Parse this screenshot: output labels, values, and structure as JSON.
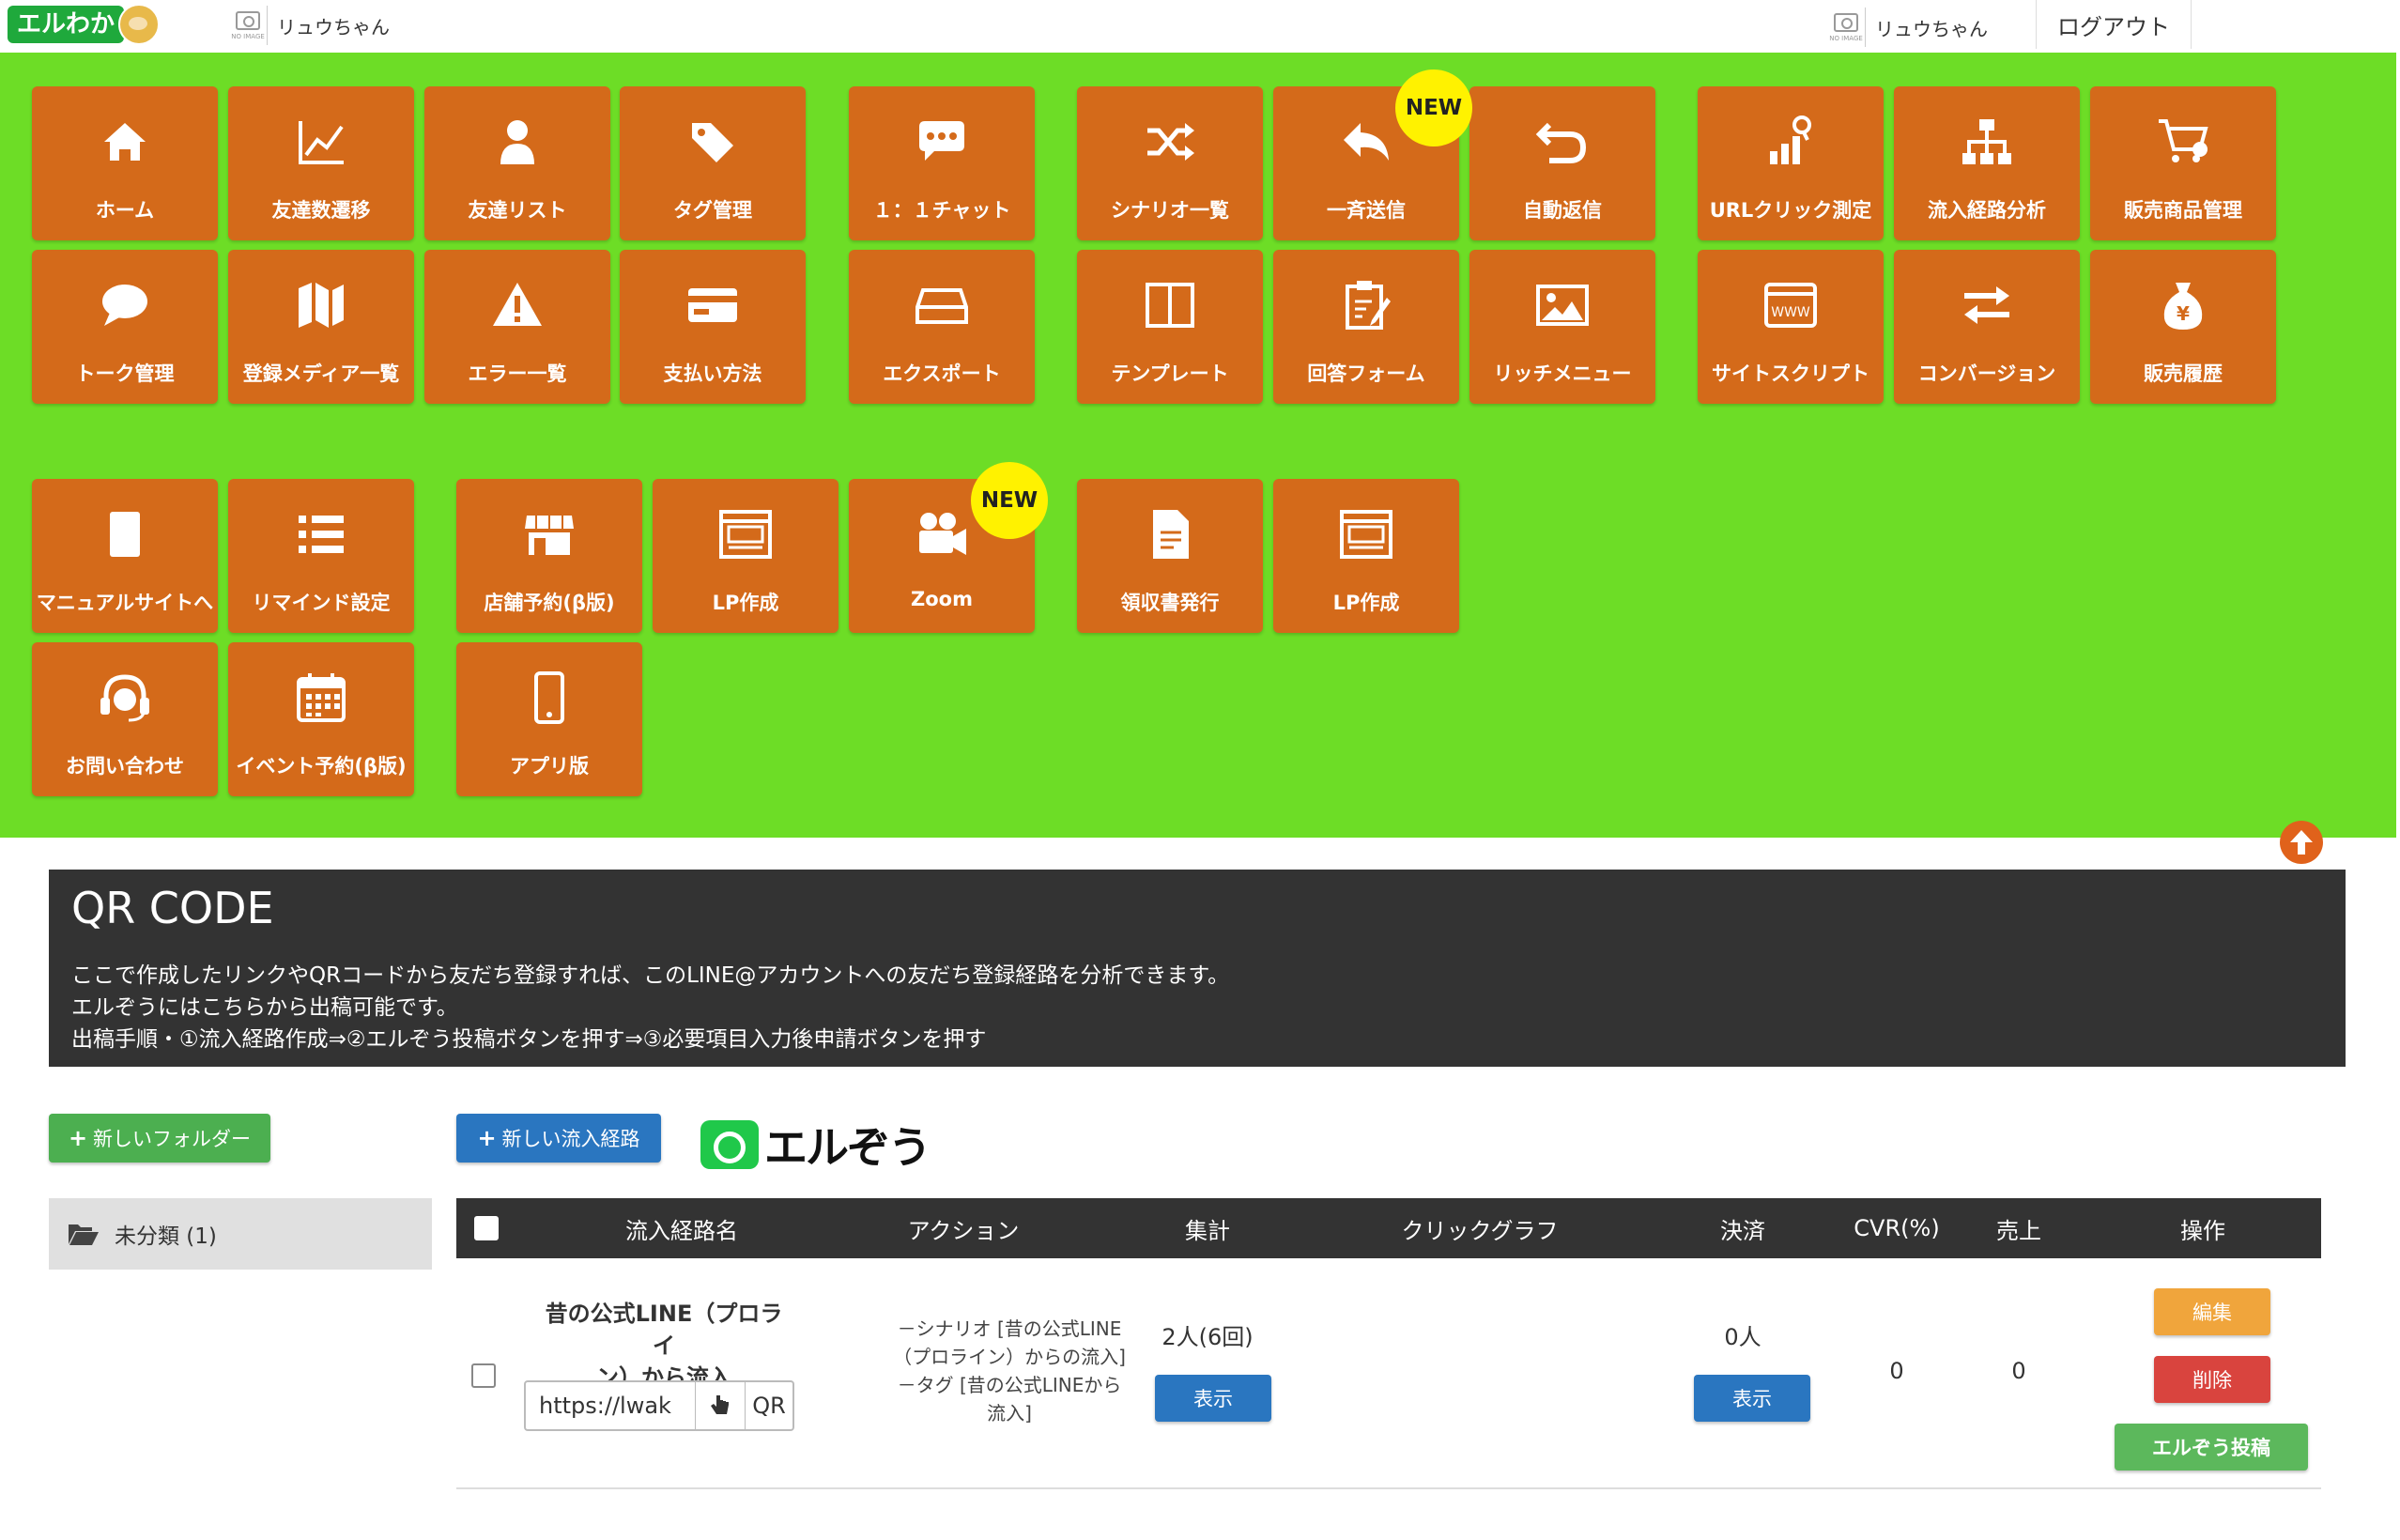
{
  "header": {
    "logo_text": "エルわか",
    "account_left": "リュウちゃん",
    "account_right": "リュウちゃん",
    "noimage_label": "NO IMAGE",
    "logout": "ログアウト"
  },
  "nav": {
    "new_badge": "NEW",
    "tiles": [
      {
        "label": "ホーム",
        "icon": "home-icon"
      },
      {
        "label": "友達数遷移",
        "icon": "line-chart-icon"
      },
      {
        "label": "友達リスト",
        "icon": "user-icon"
      },
      {
        "label": "タグ管理",
        "icon": "tags-icon"
      },
      {
        "label": "１：１チャット",
        "icon": "chat-dots-icon"
      },
      {
        "label": "シナリオ一覧",
        "icon": "shuffle-icon"
      },
      {
        "label": "一斉送信",
        "icon": "reply-icon"
      },
      {
        "label": "自動返信",
        "icon": "undo-icon"
      },
      {
        "label": "URLクリック測定",
        "icon": "bar-search-icon"
      },
      {
        "label": "流入経路分析",
        "icon": "sitemap-icon"
      },
      {
        "label": "販売商品管理",
        "icon": "cart-icon"
      },
      {
        "label": "トーク管理",
        "icon": "speech-bubble-icon"
      },
      {
        "label": "登録メディア一覧",
        "icon": "map-icon"
      },
      {
        "label": "エラー一覧",
        "icon": "warning-icon"
      },
      {
        "label": "支払い方法",
        "icon": "credit-card-icon"
      },
      {
        "label": "エクスポート",
        "icon": "inbox-icon"
      },
      {
        "label": "テンプレート",
        "icon": "columns-icon"
      },
      {
        "label": "回答フォーム",
        "icon": "clipboard-icon"
      },
      {
        "label": "リッチメニュー",
        "icon": "image-icon"
      },
      {
        "label": "サイトスクリプト",
        "icon": "www-icon"
      },
      {
        "label": "コンバージョン",
        "icon": "exchange-icon"
      },
      {
        "label": "販売履歴",
        "icon": "yen-bag-icon"
      },
      {
        "label": "マニュアルサイトへ",
        "icon": "book-icon"
      },
      {
        "label": "リマインド設定",
        "icon": "list-icon"
      },
      {
        "label": "店舗予約(β版)",
        "icon": "store-icon"
      },
      {
        "label": "LP作成",
        "icon": "webpage-icon"
      },
      {
        "label": "Zoom",
        "icon": "video-camera-icon"
      },
      {
        "label": "領収書発行",
        "icon": "document-icon"
      },
      {
        "label": "LP作成",
        "icon": "webpage-icon"
      },
      {
        "label": "お問い合わせ",
        "icon": "headset-icon"
      },
      {
        "label": "イベント予約(β版)",
        "icon": "calendar-icon"
      },
      {
        "label": "アプリ版",
        "icon": "mobile-icon"
      }
    ]
  },
  "qr": {
    "title": "QR CODE",
    "line1": "ここで作成したリンクやQRコードから友だち登録すれば、このLINE@アカウントへの友だち登録経路を分析できます。",
    "line2": "エルぞうにはこちらから出稿可能です。",
    "line3": "出稿手順・①流入経路作成⇒②エルぞう投稿ボタンを押す⇒③必要項目入力後申請ボタンを押す"
  },
  "buttons": {
    "new_folder": "新しいフォルダー",
    "new_route": "新しい流入経路",
    "elzo_logo": "エルぞう"
  },
  "folder": {
    "label": "未分類 (1)"
  },
  "table": {
    "headers": [
      "流入経路名",
      "アクション",
      "集計",
      "クリックグラフ",
      "決済",
      "CVR(%)",
      "売上",
      "操作"
    ],
    "rows": [
      {
        "name_line1": "昔の公式LINE（プロライ",
        "name_line2": "ン）から流入",
        "url": "https://lwak",
        "qr": "QR",
        "action_lines": [
          "－シナリオ [昔の公式LINE",
          "（プロライン）からの流入]",
          "－タグ [昔の公式LINEから",
          "流入]"
        ],
        "tally": "2人(6回)",
        "tally_btn": "表示",
        "payment": "0人",
        "payment_btn": "表示",
        "cvr": "0",
        "sales": "0",
        "edit": "編集",
        "delete": "削除",
        "post": "エルぞう投稿"
      }
    ]
  },
  "colors": {
    "nav_bg": "#6ddd26",
    "tile": "#d46a1a",
    "badge": "#fff200",
    "dark": "#333333",
    "edit": "#f0a53c",
    "delete": "#d9443e",
    "post": "#5cb85c",
    "blue": "#2a76c0"
  }
}
